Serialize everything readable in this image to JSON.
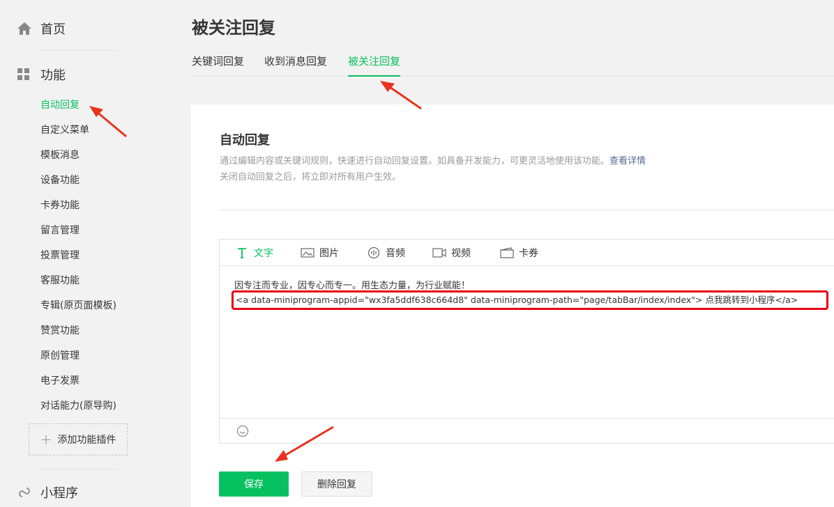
{
  "sidebar": {
    "home_label": "首页",
    "function_label": "功能",
    "items": [
      {
        "label": "自动回复",
        "active": true
      },
      {
        "label": "自定义菜单"
      },
      {
        "label": "模板消息"
      },
      {
        "label": "设备功能"
      },
      {
        "label": "卡券功能"
      },
      {
        "label": "留言管理"
      },
      {
        "label": "投票管理"
      },
      {
        "label": "客服功能"
      },
      {
        "label": "专辑(原页面模板)"
      },
      {
        "label": "赞赏功能"
      },
      {
        "label": "原创管理"
      },
      {
        "label": "电子发票"
      },
      {
        "label": "对话能力(原导购)"
      }
    ],
    "add_plugin_label": "添加功能插件",
    "miniprogram_label": "小程序"
  },
  "main": {
    "title": "被关注回复",
    "tabs": [
      {
        "label": "关键词回复"
      },
      {
        "label": "收到消息回复"
      },
      {
        "label": "被关注回复",
        "active": true
      }
    ],
    "card": {
      "title": "自动回复",
      "desc_line1": "通过编辑内容或关键词规则，快速进行自动回复设置。如具备开发能力，可更灵活地使用该功能。",
      "desc_link": "查看详情",
      "desc_line2": "关闭自动回复之后，将立即对所有用户生效。"
    },
    "editor": {
      "tools": [
        {
          "label": "文字",
          "icon": "text-icon",
          "active": true
        },
        {
          "label": "图片",
          "icon": "image-icon"
        },
        {
          "label": "音频",
          "icon": "audio-icon"
        },
        {
          "label": "视频",
          "icon": "video-icon"
        },
        {
          "label": "卡券",
          "icon": "coupon-icon"
        }
      ],
      "content_line1": "因专注而专业，因专心而专一。用生态力量，为行业赋能！",
      "content_code": "<a data-miniprogram-appid=\"wx3fa5ddf638c664d8\" data-miniprogram-path=\"page/tabBar/index/index\">   点我跳转到小程序</a>"
    },
    "buttons": {
      "save_label": "保存",
      "delete_label": "删除回复"
    }
  },
  "colors": {
    "accent": "#07c160",
    "highlight_border": "#e60012",
    "link": "#576b95"
  }
}
